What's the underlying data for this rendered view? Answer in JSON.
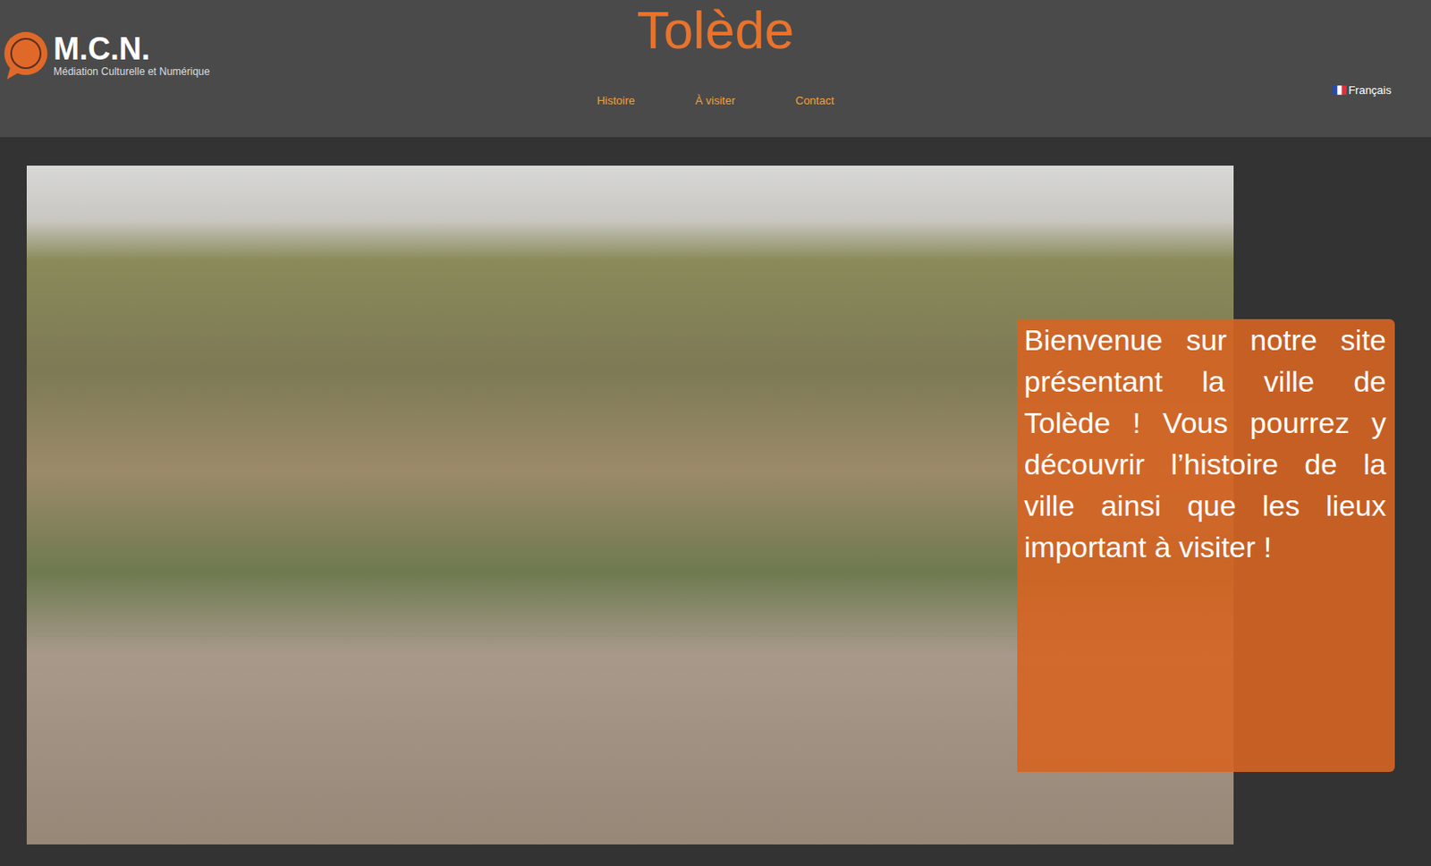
{
  "logo": {
    "name": "M.C.N.",
    "tagline": "Médiation Culturelle et Numérique"
  },
  "title": "Tolède",
  "nav": [
    "Histoire",
    "À visiter",
    "Contact"
  ],
  "language": {
    "label": "Français"
  },
  "hero": {
    "text": "Bienvenue sur notre site présentant la ville de Tolède ! Vous pourrez y découvrir l’histoire de la ville ainsi que les lieux important à visiter !"
  }
}
